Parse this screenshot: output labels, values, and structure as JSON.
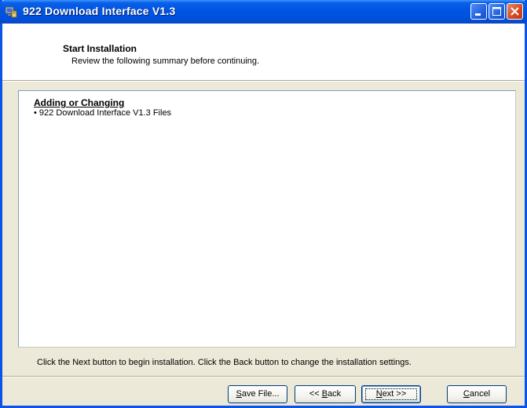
{
  "window": {
    "title": "922 Download Interface V1.3",
    "icon": "setup-computer-icon",
    "controls": [
      "minimize-icon",
      "maximize-icon",
      "close-icon"
    ],
    "accent_color": "#0054e3"
  },
  "header": {
    "title": "Start Installation",
    "subtitle": "Review the following summary before continuing."
  },
  "summary": {
    "heading": "Adding or Changing",
    "items": [
      "• 922 Download Interface V1.3 Files"
    ]
  },
  "footer": {
    "instruction": "Click the Next button to begin installation.  Click the Back button to change the installation settings."
  },
  "buttons": {
    "save": {
      "prefix": "",
      "accel": "S",
      "suffix": "ave File..."
    },
    "back": {
      "prefix": "<< ",
      "accel": "B",
      "suffix": "ack"
    },
    "next": {
      "prefix": "",
      "accel": "N",
      "suffix": "ext >>"
    },
    "cancel": {
      "prefix": "",
      "accel": "C",
      "suffix": "ancel"
    }
  }
}
